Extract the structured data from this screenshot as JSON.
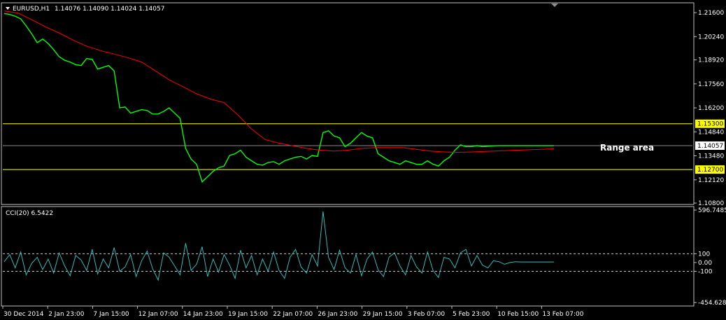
{
  "window": {
    "header_symbol": "EURUSD,H1",
    "header_ohlc": "1.14076 1.14090 1.14024 1.14057"
  },
  "colors": {
    "background": "#000000",
    "frame": "#c0c0c0",
    "price_line": "#00ff00",
    "moving_average": "#ff0000",
    "support_resistance": "#ffff00",
    "current_price_line": "#8c8c8c",
    "cci_line": "#33bbbb",
    "cci_levels": "#c8c8c8",
    "text": "#ffffff"
  },
  "chart_data": [
    {
      "type": "line",
      "name": "EURUSD,H1",
      "ylim": [
        1.108,
        1.22
      ],
      "y_ticks": [
        1.216,
        1.2024,
        1.1892,
        1.1756,
        1.162,
        1.1484,
        1.1348,
        1.1212,
        1.108
      ],
      "y_tick_labels": [
        "1.21600",
        "1.20240",
        "1.18920",
        "1.17560",
        "1.16200",
        "1.14840",
        "1.13480",
        "1.12120",
        "1.10800"
      ],
      "price_tags": [
        {
          "label": "1.15300",
          "value": 1.153,
          "style": "yellow"
        },
        {
          "label": "1.14057",
          "value": 1.14057,
          "style": "current"
        },
        {
          "label": "1.12700",
          "value": 1.127,
          "style": "yellow"
        }
      ],
      "horizontal_lines": [
        1.153,
        1.127
      ],
      "annotation": "Range area",
      "series": [
        {
          "role": "price",
          "x": [
            0,
            2,
            4,
            6,
            8,
            10,
            12,
            14,
            16,
            18,
            20,
            22,
            24,
            26,
            28,
            30,
            32,
            34,
            36,
            38,
            40,
            42,
            44,
            46,
            48,
            50,
            52,
            54,
            56,
            58,
            60,
            62,
            64,
            66,
            68,
            70,
            72,
            74,
            76,
            78,
            80,
            82,
            84,
            86,
            88,
            90,
            92,
            94,
            96,
            98,
            100,
            102,
            104,
            106,
            108,
            110,
            112,
            114,
            116,
            118,
            120,
            122,
            124,
            126,
            128,
            130,
            132,
            134,
            136,
            138,
            140,
            142,
            144,
            146,
            148,
            150,
            152,
            154,
            156,
            158,
            160,
            162,
            164,
            166,
            168,
            170,
            172,
            174,
            176,
            178,
            180,
            182,
            184,
            186,
            188,
            190,
            192,
            194,
            196,
            198,
            200
          ],
          "values": [
            1.2155,
            1.215,
            1.214,
            1.2125,
            1.2085,
            1.204,
            1.199,
            1.201,
            1.1985,
            1.195,
            1.191,
            1.189,
            1.188,
            1.1865,
            1.186,
            1.19,
            1.1895,
            1.184,
            1.185,
            1.186,
            1.183,
            1.162,
            1.1625,
            1.159,
            1.16,
            1.161,
            1.1605,
            1.1585,
            1.1585,
            1.16,
            1.162,
            1.159,
            1.156,
            1.139,
            1.133,
            1.13,
            1.12,
            1.123,
            1.126,
            1.128,
            1.129,
            1.135,
            1.136,
            1.138,
            1.134,
            1.132,
            1.13,
            1.1295,
            1.131,
            1.1315,
            1.13,
            1.132,
            1.133,
            1.134,
            1.1345,
            1.133,
            1.135,
            1.1345,
            1.148,
            1.149,
            1.146,
            1.145,
            1.14,
            1.142,
            1.145,
            1.148,
            1.146,
            1.145,
            1.136,
            1.134,
            1.132,
            1.131,
            1.13,
            1.132,
            1.131,
            1.13,
            1.13,
            1.132,
            1.13,
            1.129,
            1.132,
            1.134,
            1.138,
            1.141,
            1.14,
            1.14,
            1.1406,
            1.14,
            1.1402,
            1.1405,
            1.1406,
            1.1406,
            1.1406,
            1.1406,
            1.1406,
            1.1406,
            1.1406,
            1.1406,
            1.1406,
            1.1406,
            1.1406
          ]
        },
        {
          "role": "moving_average",
          "x": [
            0,
            5,
            10,
            15,
            20,
            25,
            30,
            35,
            40,
            45,
            50,
            55,
            60,
            65,
            70,
            75,
            80,
            85,
            90,
            95,
            100,
            105,
            110,
            115,
            120,
            125,
            130,
            135,
            140,
            145,
            150,
            155,
            160,
            165,
            170,
            175,
            180,
            185,
            190,
            195,
            200
          ],
          "values": [
            1.217,
            1.2158,
            1.212,
            1.208,
            1.2045,
            1.2005,
            1.197,
            1.1945,
            1.1925,
            1.1905,
            1.188,
            1.183,
            1.178,
            1.174,
            1.17,
            1.167,
            1.165,
            1.158,
            1.15,
            1.144,
            1.142,
            1.1405,
            1.139,
            1.138,
            1.1375,
            1.138,
            1.139,
            1.1395,
            1.1395,
            1.1395,
            1.1385,
            1.1375,
            1.137,
            1.1368,
            1.137,
            1.1373,
            1.1376,
            1.1379,
            1.1382,
            1.1385,
            1.1388
          ]
        }
      ]
    },
    {
      "type": "line",
      "name": "CCI(20)",
      "header": "CCI(20) 6.5422",
      "ylim": [
        -454.6282,
        596.7485
      ],
      "y_tick_labels": [
        "596.7485",
        "100",
        "0.00",
        "-100",
        "-454.6282"
      ],
      "y_ticks": [
        596.7485,
        100,
        0,
        -100,
        -454.6282
      ],
      "levels": [
        100,
        -100
      ],
      "series": [
        {
          "name": "CCI(20)",
          "x": [
            0,
            2,
            4,
            6,
            8,
            10,
            12,
            14,
            16,
            18,
            20,
            22,
            24,
            26,
            28,
            30,
            32,
            34,
            36,
            38,
            40,
            42,
            44,
            46,
            48,
            50,
            52,
            54,
            56,
            58,
            60,
            62,
            64,
            66,
            68,
            70,
            72,
            74,
            76,
            78,
            80,
            82,
            84,
            86,
            88,
            90,
            92,
            94,
            96,
            98,
            100,
            102,
            104,
            106,
            108,
            110,
            112,
            114,
            116,
            118,
            120,
            122,
            124,
            126,
            128,
            130,
            132,
            134,
            136,
            138,
            140,
            142,
            144,
            146,
            148,
            150,
            152,
            154,
            156,
            158,
            160,
            162,
            164,
            166,
            168,
            170,
            172,
            174,
            176,
            178,
            180,
            182,
            184,
            186,
            188,
            190,
            192,
            194,
            196,
            198,
            200
          ],
          "values": [
            10,
            90,
            -60,
            120,
            -140,
            -10,
            60,
            -80,
            40,
            -120,
            110,
            -40,
            -150,
            80,
            30,
            -90,
            150,
            -130,
            40,
            -60,
            170,
            -100,
            -50,
            90,
            -160,
            20,
            130,
            -70,
            -200,
            110,
            60,
            -40,
            -140,
            220,
            -90,
            -20,
            180,
            -160,
            40,
            -110,
            90,
            -30,
            -180,
            140,
            -60,
            80,
            -140,
            40,
            -100,
            120,
            -90,
            -180,
            60,
            150,
            -50,
            -120,
            90,
            -40,
            580,
            60,
            -80,
            140,
            -60,
            -120,
            90,
            -150,
            40,
            120,
            -80,
            -160,
            60,
            110,
            -40,
            -140,
            80,
            -50,
            -120,
            120,
            -90,
            -170,
            60,
            40,
            -60,
            110,
            150,
            -40,
            80,
            -30,
            -60,
            20,
            10,
            -20,
            0,
            10,
            6.54,
            6.54,
            6.54,
            6.54,
            6.54,
            6.54,
            6.54
          ]
        }
      ]
    }
  ],
  "x_axis": {
    "tick_labels": [
      "30 Dec 2014",
      "2 Jan 23:00",
      "7 Jan 15:00",
      "12 Jan 07:00",
      "14 Jan 23:00",
      "19 Jan 15:00",
      "22 Jan 07:00",
      "26 Jan 23:00",
      "29 Jan 15:00",
      "3 Feb 07:00",
      "5 Feb 23:00",
      "10 Feb 15:00",
      "13 Feb 07:00"
    ]
  }
}
